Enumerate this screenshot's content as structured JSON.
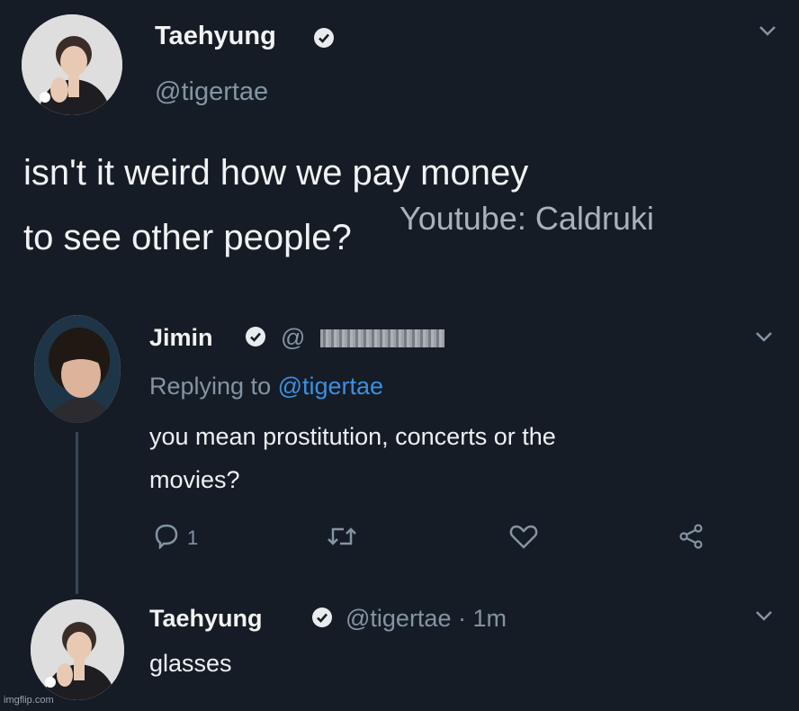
{
  "tweet": {
    "author_name": "Taehyung",
    "handle": "@tigertae",
    "text_line1": "isn't it weird how we pay money",
    "text_line2": "to see other people?",
    "watermark": "Youtube: Caldruki"
  },
  "reply": {
    "author_name": "Jimin",
    "handle_prefix": "@",
    "replying_to_label": "Replying to",
    "replying_to_handle": "@tigertae",
    "text_line1": "you mean prostitution, concerts or the",
    "text_line2": "movies?",
    "reply_count": "1"
  },
  "reply2": {
    "author_name": "Taehyung",
    "handle": "@tigertae",
    "time": "· 1m",
    "text": "glasses"
  },
  "footer": {
    "imgflip": "imgflip.com"
  },
  "colors": {
    "background": "#151c26",
    "link": "#3d8fe0",
    "muted": "#8494a3",
    "text": "#e9ecef"
  },
  "icons": [
    "chevron-down-icon",
    "verified-icon",
    "reply-icon",
    "retweet-icon",
    "like-icon",
    "share-icon"
  ]
}
